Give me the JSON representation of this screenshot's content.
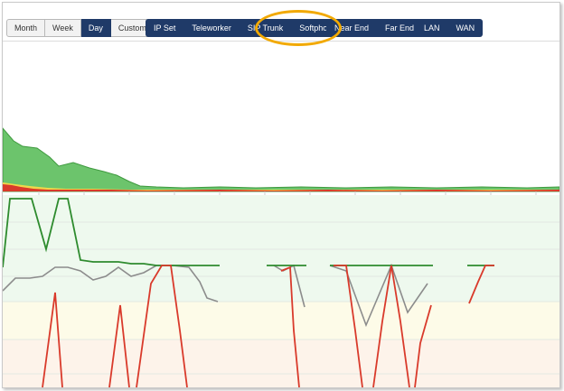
{
  "range_buttons": [
    {
      "label": "Month",
      "active": false
    },
    {
      "label": "Week",
      "active": false
    },
    {
      "label": "Day",
      "active": true
    },
    {
      "label": "Custom",
      "active": false
    }
  ],
  "device_buttons": [
    "IP Set",
    "Teleworker",
    "SIP Trunk",
    "Softphone"
  ],
  "end_buttons": [
    "Near End",
    "Far End"
  ],
  "network_buttons": [
    "LAN",
    "WAN"
  ],
  "highlighted": "Softphone",
  "colors": {
    "navy": "#1f3a68",
    "highlight": "#f2a900",
    "series_green": "#2e8b2e",
    "series_red": "#d93a2b",
    "series_gray": "#8c8c8c",
    "area_green": "#6cc46c",
    "band_green": "#eef9ee",
    "band_yellow": "#fdfbe8",
    "band_peach": "#fdf3ea"
  }
}
